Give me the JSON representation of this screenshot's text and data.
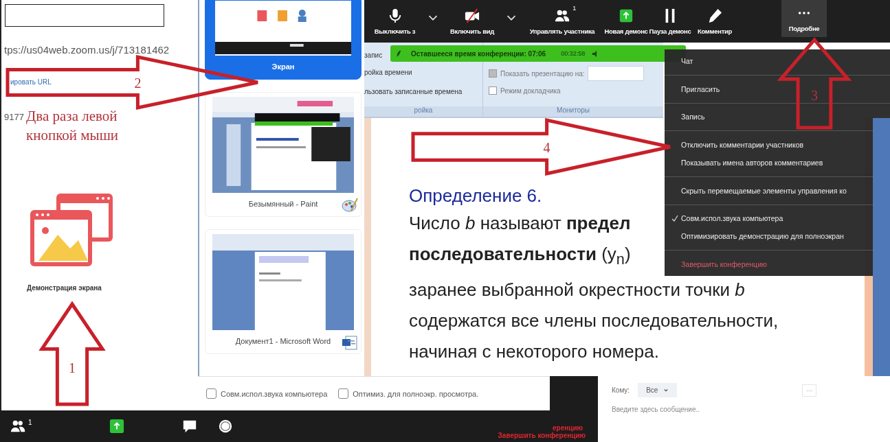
{
  "left_panel": {
    "url": "tps://us04web.zoom.us/j/713181462",
    "copy_link": "ировать URL",
    "id_fragment": "9177",
    "share_label": "Демонстрация экрана"
  },
  "caption": "Два раза левой кнопкой мыши",
  "arrows": [
    {
      "number": "1",
      "kind": "up"
    },
    {
      "number": "2",
      "kind": "right"
    },
    {
      "number": "3",
      "kind": "up"
    },
    {
      "number": "4",
      "kind": "right"
    }
  ],
  "share_picker": {
    "sources": [
      {
        "label": "Экран",
        "selected": true
      },
      {
        "label": "Безымянный - Paint",
        "selected": false
      },
      {
        "label": "Документ1 - Microsoft Word",
        "selected": false
      }
    ],
    "options": [
      {
        "label": "Совм.испол.звука компьютера",
        "checked": false
      },
      {
        "label": "Оптимиз. для полноэкр. просмотра.",
        "checked": false
      }
    ]
  },
  "toolbar": {
    "buttons": [
      {
        "label": "Выключить з",
        "dropdown": true
      },
      {
        "label": "Включить вид",
        "dropdown": true
      },
      {
        "label": "Управлять участника",
        "dropdown": false,
        "badge": "1"
      },
      {
        "label": "Новая демонс",
        "dropdown": false
      },
      {
        "label": "Пауза демонс",
        "dropdown": false
      },
      {
        "label": "Комментир",
        "dropdown": false
      },
      {
        "label": "Подробне",
        "dropdown": false
      }
    ]
  },
  "timer_bar": {
    "text": "Оставшееся время конференции: 07:06",
    "elapsed": "00:32:58"
  },
  "ribbon": {
    "left_lines": [
      "запис",
      "ройка времени",
      "льзовать записанные времена"
    ],
    "left_group": "ройка",
    "checkboxes": [
      {
        "label": "Показать презентацию на:",
        "checked": true
      },
      {
        "label": "Режим докладчика",
        "checked": false
      }
    ],
    "right_group": "Мониторы"
  },
  "slide": {
    "title": "Определение 6.",
    "lines": [
      "Число *b* называют **предел**",
      "**последовательности** (y$_{n}$)",
      "заранее выбранной окрестности точки *b*",
      "содержатся все члены последовательности,",
      "начиная с некоторого номера."
    ]
  },
  "menu": {
    "items": [
      {
        "label": "Чат",
        "separator_before": false,
        "checked": false,
        "kind": "normal"
      },
      {
        "label": "Пригласить",
        "separator_before": true,
        "checked": false,
        "kind": "normal"
      },
      {
        "label": "Запись",
        "separator_before": true,
        "checked": false,
        "kind": "normal"
      },
      {
        "label": "Отключить комментарии участников",
        "separator_before": true,
        "checked": false,
        "kind": "normal"
      },
      {
        "label": "Показывать имена авторов комментариев",
        "separator_before": false,
        "checked": false,
        "kind": "normal"
      },
      {
        "label": "Скрыть перемещаемые элементы управления ко",
        "separator_before": true,
        "checked": false,
        "kind": "normal"
      },
      {
        "label": "Совм.испол.звука компьютера",
        "separator_before": true,
        "checked": true,
        "kind": "normal"
      },
      {
        "label": "Оптимизировать демонстрацию для полноэкран",
        "separator_before": false,
        "checked": false,
        "kind": "normal"
      },
      {
        "label": "Завершить конференцию",
        "separator_before": true,
        "checked": false,
        "kind": "danger"
      }
    ]
  },
  "bottom_bar": {
    "participant_count": "1",
    "end_button": "Завершить конференцию",
    "end_fragment": "еренцию"
  },
  "chat": {
    "to_label": "Кому:",
    "recipient": "Все",
    "more": "···",
    "placeholder": "Введите здесь сообщение.."
  }
}
